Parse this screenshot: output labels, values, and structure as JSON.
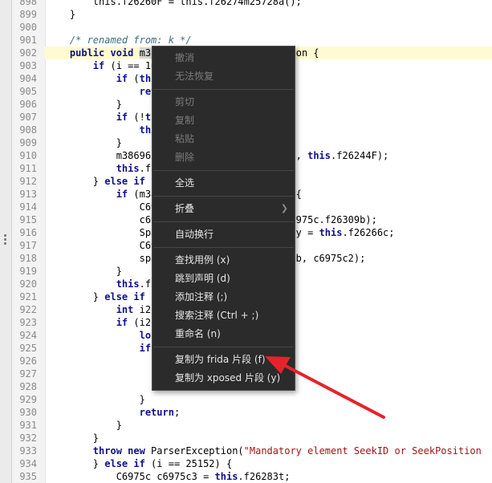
{
  "code_lines": [
    {
      "n": "898",
      "t": [
        {
          "s": "        this.f26260F = this.f26274m25728a();",
          "c": ""
        }
      ]
    },
    {
      "n": "899",
      "t": [
        {
          "s": "    }",
          "c": ""
        }
      ]
    },
    {
      "n": "900",
      "t": []
    },
    {
      "n": "901",
      "t": [
        {
          "s": "    /* renamed from: k */",
          "c": "cm"
        }
      ]
    },
    {
      "n": "902",
      "hl": true,
      "t": [
        {
          "s": "    ",
          "c": ""
        },
        {
          "s": "public",
          "c": "kw"
        },
        {
          "s": " ",
          "c": ""
        },
        {
          "s": "void",
          "c": "kw"
        },
        {
          "s": " ",
          "c": ""
        },
        {
          "s": "m38",
          "c": "sel"
        },
        {
          "s": "                 Exception {",
          "c": ""
        }
      ]
    },
    {
      "n": "903",
      "t": [
        {
          "s": "        ",
          "c": ""
        },
        {
          "s": "if",
          "c": "kw"
        },
        {
          "s": " (i == 16",
          "c": ""
        }
      ]
    },
    {
      "n": "904",
      "t": [
        {
          "s": "            ",
          "c": ""
        },
        {
          "s": "if",
          "c": "kw"
        },
        {
          "s": " (",
          "c": ""
        },
        {
          "s": "thi",
          "c": "kw"
        }
      ]
    },
    {
      "n": "905",
      "t": [
        {
          "s": "                ",
          "c": ""
        },
        {
          "s": "ret",
          "c": "kw"
        }
      ]
    },
    {
      "n": "906",
      "t": [
        {
          "s": "            }",
          "c": ""
        }
      ]
    },
    {
      "n": "907",
      "t": [
        {
          "s": "            ",
          "c": ""
        },
        {
          "s": "if",
          "c": "kw"
        },
        {
          "s": " (!",
          "c": ""
        },
        {
          "s": "th",
          "c": "kw"
        }
      ]
    },
    {
      "n": "908",
      "t": [
        {
          "s": "                ",
          "c": ""
        },
        {
          "s": "thi",
          "c": "kw"
        }
      ]
    },
    {
      "n": "909",
      "t": [
        {
          "s": "            }",
          "c": ""
        }
      ]
    },
    {
      "n": "910",
      "t": [
        {
          "s": "            m38696i                  6249K), ",
          "c": ""
        },
        {
          "s": "this",
          "c": "kw"
        },
        {
          "s": ".f26244F);",
          "c": ""
        }
      ]
    },
    {
      "n": "911",
      "t": [
        {
          "s": "            ",
          "c": ""
        },
        {
          "s": "this",
          "c": "kw"
        },
        {
          "s": ".f2",
          "c": ""
        }
      ]
    },
    {
      "n": "912",
      "t": [
        {
          "s": "        } ",
          "c": ""
        },
        {
          "s": "else if",
          "c": "kw"
        },
        {
          "s": " (",
          "c": ""
        }
      ]
    },
    {
      "n": "913",
      "t": [
        {
          "s": "            ",
          "c": ""
        },
        {
          "s": "if",
          "c": "kw"
        },
        {
          "s": " (m38                     )) {",
          "c": ""
        }
      ]
    },
    {
      "n": "914",
      "t": [
        {
          "s": "                C69                      ;",
          "c": ""
        }
      ]
    },
    {
      "n": "915",
      "t": [
        {
          "s": "                c69                      c6975c.f26309b);",
          "c": ""
        }
      ]
    },
    {
      "n": "916",
      "t": [
        {
          "s": "                Spa                      ray = ",
          "c": ""
        },
        {
          "s": "this",
          "c": "kw"
        },
        {
          "s": ".f26266c;",
          "c": ""
        }
      ]
    },
    {
      "n": "917",
      "t": [
        {
          "s": "                C69                      c;",
          "c": ""
        }
      ]
    },
    {
      "n": "918",
      "t": [
        {
          "s": "                spa                      09b, c6975c2);",
          "c": ""
        }
      ]
    },
    {
      "n": "919",
      "t": [
        {
          "s": "            }",
          "c": ""
        }
      ]
    },
    {
      "n": "920",
      "t": [
        {
          "s": "            ",
          "c": ""
        },
        {
          "s": "this",
          "c": "kw"
        },
        {
          "s": ".f2",
          "c": ""
        }
      ]
    },
    {
      "n": "921",
      "t": [
        {
          "s": "        } ",
          "c": ""
        },
        {
          "s": "else if",
          "c": "kw"
        },
        {
          "s": " (",
          "c": ""
        }
      ]
    },
    {
      "n": "922",
      "t": [
        {
          "s": "            ",
          "c": ""
        },
        {
          "s": "int",
          "c": "kw"
        },
        {
          "s": " i2",
          "c": ""
        }
      ]
    },
    {
      "n": "923",
      "t": [
        {
          "s": "            ",
          "c": ""
        },
        {
          "s": "if",
          "c": "kw"
        },
        {
          "s": " (i2",
          "c": ""
        }
      ]
    },
    {
      "n": "924",
      "t": [
        {
          "s": "                ",
          "c": ""
        },
        {
          "s": "lon",
          "c": "kw"
        }
      ]
    },
    {
      "n": "925",
      "t": [
        {
          "s": "                ",
          "c": ""
        },
        {
          "s": "if",
          "c": "kw"
        }
      ]
    },
    {
      "n": "926",
      "t": []
    },
    {
      "n": "927",
      "t": []
    },
    {
      "n": "928",
      "t": []
    },
    {
      "n": "929",
      "t": [
        {
          "s": "                }",
          "c": ""
        }
      ]
    },
    {
      "n": "930",
      "t": [
        {
          "s": "                ",
          "c": ""
        },
        {
          "s": "return",
          "c": "kw"
        },
        {
          "s": ";",
          "c": ""
        }
      ]
    },
    {
      "n": "931",
      "t": [
        {
          "s": "            }",
          "c": ""
        }
      ]
    },
    {
      "n": "932",
      "t": [
        {
          "s": "        }",
          "c": ""
        }
      ]
    },
    {
      "n": "933",
      "t": [
        {
          "s": "        ",
          "c": ""
        },
        {
          "s": "throw new",
          "c": "kw"
        },
        {
          "s": " ParserException(",
          "c": ""
        },
        {
          "s": "\"Mandatory element SeekID or SeekPosition",
          "c": "st"
        }
      ]
    },
    {
      "n": "934",
      "t": [
        {
          "s": "        } ",
          "c": ""
        },
        {
          "s": "else if",
          "c": "kw"
        },
        {
          "s": " (i == 25152) {",
          "c": ""
        }
      ]
    },
    {
      "n": "935",
      "t": [
        {
          "s": "            C6975c c6975c3 = ",
          "c": ""
        },
        {
          "s": "this",
          "c": "kw"
        },
        {
          "s": ".f26283t;",
          "c": ""
        }
      ]
    }
  ],
  "context_menu": {
    "items": [
      {
        "id": "undo",
        "label": "撤消",
        "disabled": true
      },
      {
        "id": "redo",
        "label": "无法恢复",
        "disabled": true
      },
      {
        "sep": true
      },
      {
        "id": "cut",
        "label": "剪切",
        "disabled": true
      },
      {
        "id": "copy",
        "label": "复制",
        "disabled": true
      },
      {
        "id": "paste",
        "label": "粘贴",
        "disabled": true
      },
      {
        "id": "delete",
        "label": "删除",
        "disabled": true
      },
      {
        "sep": true
      },
      {
        "id": "select-all",
        "label": "全选",
        "disabled": false
      },
      {
        "sep": true
      },
      {
        "id": "fold",
        "label": "折叠",
        "disabled": false,
        "submenu": true
      },
      {
        "sep": true
      },
      {
        "id": "word-wrap",
        "label": "自动换行",
        "disabled": false
      },
      {
        "sep": true
      },
      {
        "id": "find-usages",
        "label": "查找用例 (x)",
        "disabled": false
      },
      {
        "id": "goto-declaration",
        "label": "跳到声明 (d)",
        "disabled": false
      },
      {
        "id": "add-comment",
        "label": "添加注释 (;)",
        "disabled": false
      },
      {
        "id": "search-comments",
        "label": "搜索注释 (Ctrl + ;)",
        "disabled": false
      },
      {
        "id": "rename",
        "label": "重命名 (n)",
        "disabled": false
      },
      {
        "sep": true
      },
      {
        "id": "copy-as-frida",
        "label": "复制为 frida 片段 (f)",
        "disabled": false
      },
      {
        "id": "copy-as-xposed",
        "label": "复制为 xposed 片段 (y)",
        "disabled": false
      }
    ],
    "submenu_icon": "chevron-right-icon"
  },
  "annotation": {
    "icon": "red-arrow-icon",
    "color": "#e8222a"
  }
}
